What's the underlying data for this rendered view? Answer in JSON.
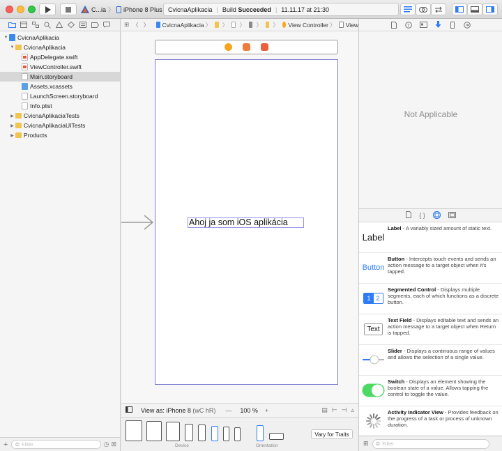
{
  "toolbar": {
    "scheme_target": "C...ia",
    "scheme_device": "iPhone 8 Plus",
    "activity_project": "CvicnaAplikacia",
    "activity_status_prefix": "Build",
    "activity_status_result": "Succeeded",
    "activity_time": "11.11.17 at 21:30"
  },
  "navigator": {
    "items": [
      {
        "label": "CvicnaAplikacia",
        "icon": "project-icon",
        "level": 0,
        "disclosure": "▼"
      },
      {
        "label": "CvicnaAplikacia",
        "icon": "folder-icon",
        "level": 1,
        "disclosure": "▼"
      },
      {
        "label": "AppDelegate.swift",
        "icon": "swift-file-icon",
        "level": 2,
        "disclosure": ""
      },
      {
        "label": "ViewController.swift",
        "icon": "swift-file-icon",
        "level": 2,
        "disclosure": ""
      },
      {
        "label": "Main.storyboard",
        "icon": "storyboard-icon",
        "level": 2,
        "disclosure": "",
        "selected": true
      },
      {
        "label": "Assets.xcassets",
        "icon": "assets-icon",
        "level": 2,
        "disclosure": ""
      },
      {
        "label": "LaunchScreen.storyboard",
        "icon": "storyboard-icon",
        "level": 2,
        "disclosure": ""
      },
      {
        "label": "Info.plist",
        "icon": "plist-icon",
        "level": 2,
        "disclosure": ""
      },
      {
        "label": "CvicnaAplikaciaTests",
        "icon": "folder-icon",
        "level": 1,
        "disclosure": "▶"
      },
      {
        "label": "CvicnaAplikaciaUITests",
        "icon": "folder-icon",
        "level": 1,
        "disclosure": "▶"
      },
      {
        "label": "Products",
        "icon": "folder-icon",
        "level": 1,
        "disclosure": "▶"
      }
    ],
    "filter_placeholder": "Filter"
  },
  "jumpbar": {
    "project": "CvicnaAplikacia",
    "scene": "View Controller",
    "view": "View"
  },
  "canvas": {
    "label_text": "Ahoj ja som iOS aplikácia",
    "view_as": "View as: iPhone 8",
    "view_as_traits": "(wC hR)",
    "zoom_minus": "—",
    "zoom": "100 %",
    "zoom_plus": "+",
    "device_caption": "Device",
    "orientation_caption": "Orientation",
    "vary_for_traits": "Vary for Traits"
  },
  "inspector": {
    "empty_message": "Not Applicable"
  },
  "library": {
    "items": [
      {
        "thumb": "Label",
        "title": "Label",
        "desc": " - A variably sized amount of static text."
      },
      {
        "thumb": "Button",
        "title": "Button",
        "desc": " - Intercepts touch events and sends an action message to a target object when it's tapped."
      },
      {
        "thumb": "segmented",
        "title": "Segmented Control",
        "desc": " - Displays multiple segments, each of which functions as a discrete button."
      },
      {
        "thumb": "Text",
        "title": "Text Field",
        "desc": " - Displays editable text and sends an action message to a target object when Return is tapped."
      },
      {
        "thumb": "slider",
        "title": "Slider",
        "desc": " - Displays a continuous range of values and allows the selection of a single value."
      },
      {
        "thumb": "switch",
        "title": "Switch",
        "desc": " - Displays an element showing the boolean state of a value. Allows tapping the control to toggle the value."
      },
      {
        "thumb": "spinner",
        "title": "Activity Indicator View",
        "desc": " - Provides feedback on the progress of a task or process of unknown duration."
      }
    ],
    "segment_labels": [
      "1",
      "2"
    ],
    "filter_placeholder": "Filter"
  },
  "colors": {
    "accent": "#2f7bf6",
    "switch_on": "#4cd964",
    "vc_border": "#7c7cd0"
  }
}
